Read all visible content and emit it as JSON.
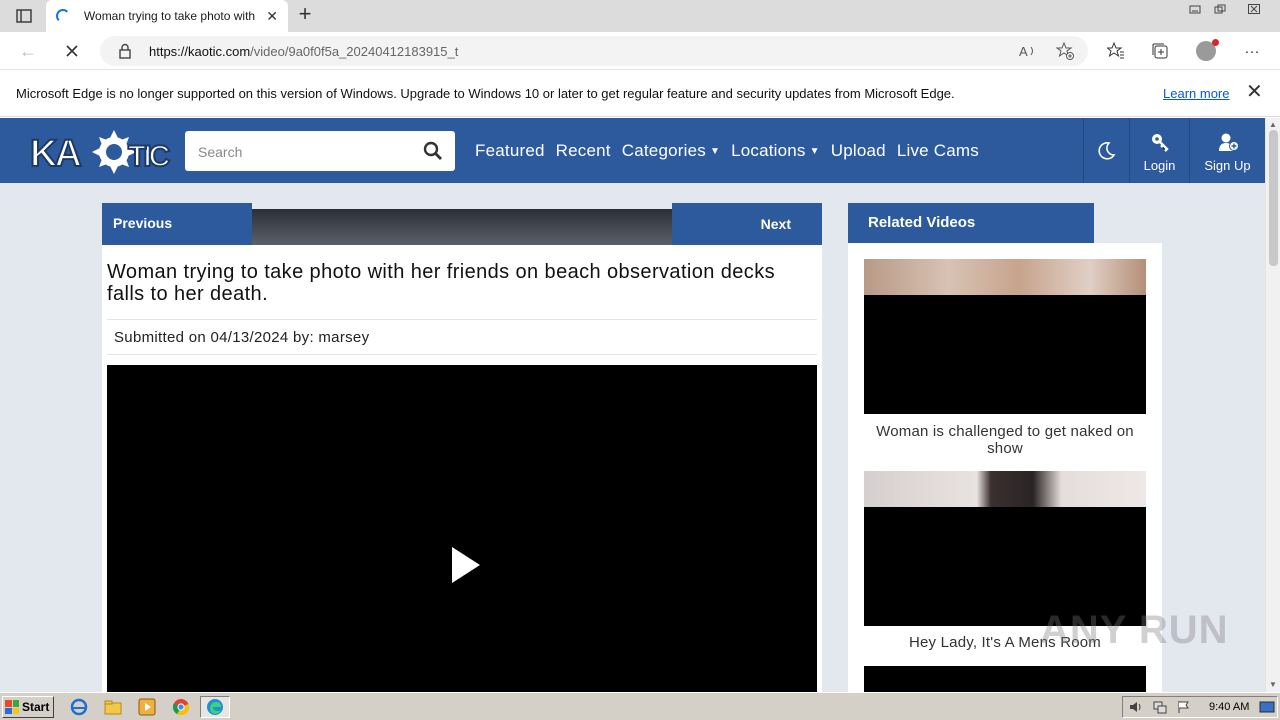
{
  "browser": {
    "tab_title": "Woman trying to take photo with",
    "url_domain": "https://kaotic.com",
    "url_path": "/video/9a0f0f5a_20240412183915_t",
    "reader_label": "A)"
  },
  "infobar": {
    "message": "Microsoft Edge is no longer supported on this version of Windows. Upgrade to Windows 10 or later to get regular feature and security updates from Microsoft Edge.",
    "learn_more": "Learn more"
  },
  "site": {
    "search_placeholder": "Search",
    "nav": [
      {
        "label": "Featured"
      },
      {
        "label": "Recent"
      },
      {
        "label": "Categories",
        "dropdown": true
      },
      {
        "label": "Locations",
        "dropdown": true
      },
      {
        "label": "Upload"
      },
      {
        "label": "Live Cams"
      }
    ],
    "login_label": "Login",
    "signup_label": "Sign Up",
    "brand_color": "#2c5a9c"
  },
  "video": {
    "previous_label": "Previous",
    "next_label": "Next",
    "title": "Woman trying to take photo with her friends on beach observation decks falls to her death.",
    "submitted_prefix": "Submitted on 04/13/2024 by:",
    "submitter": "marsey"
  },
  "related": {
    "heading": "Related Videos",
    "items": [
      {
        "caption": "Woman is challenged to get naked on show"
      },
      {
        "caption": "Hey Lady, It's A Mens Room"
      }
    ]
  },
  "watermark": "ANY RUN",
  "taskbar": {
    "start_label": "Start",
    "clock": "9:40 AM"
  }
}
